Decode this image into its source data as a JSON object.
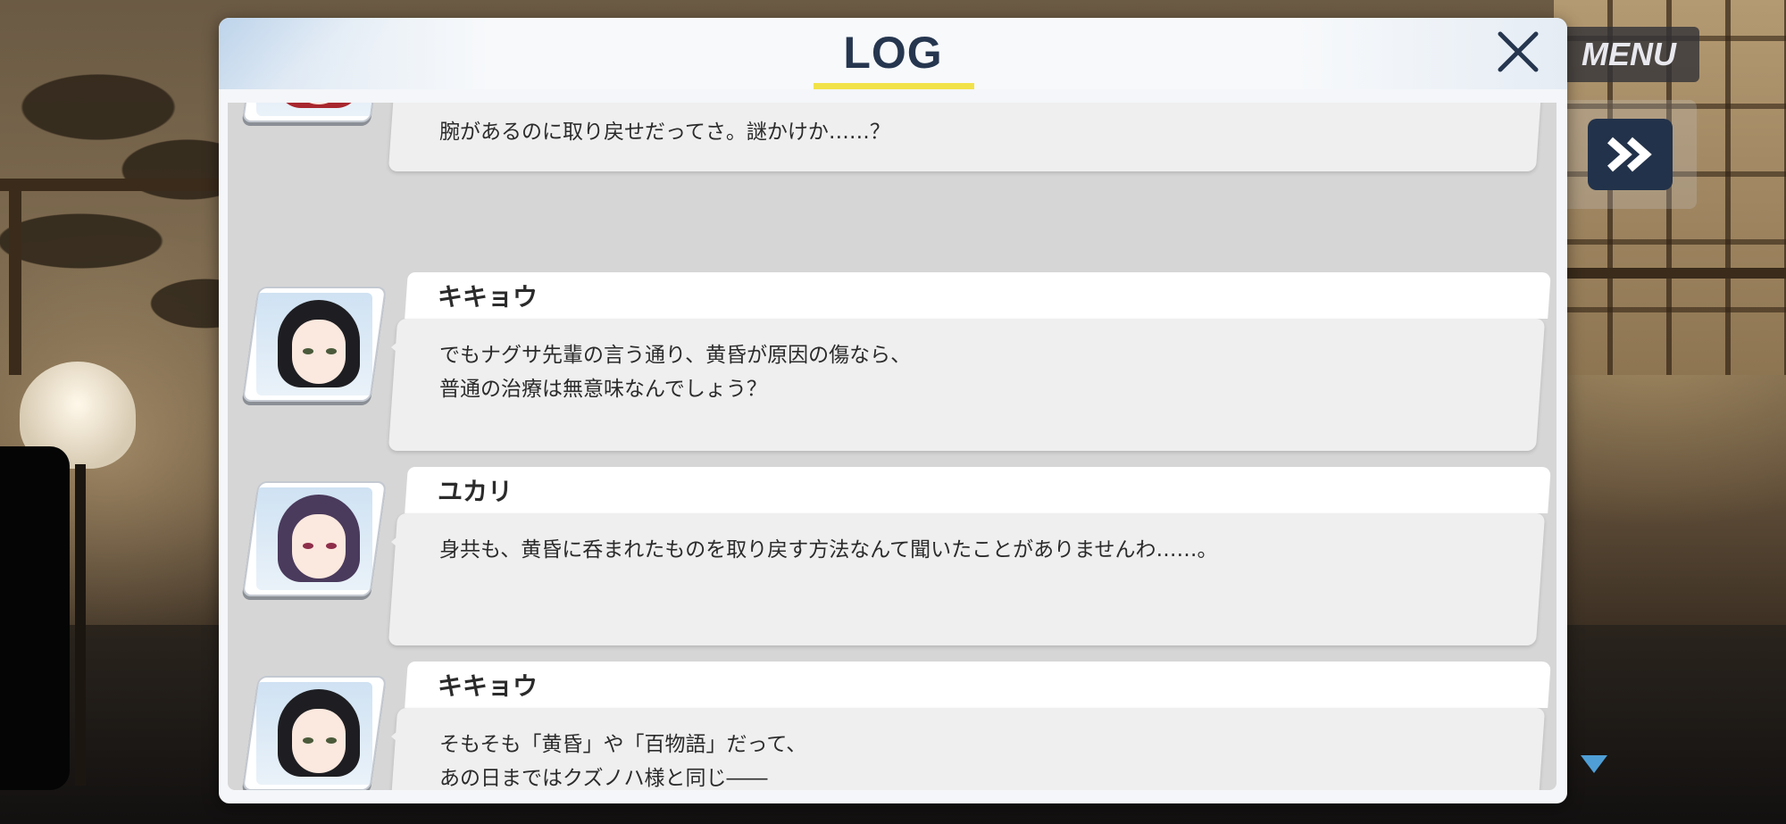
{
  "background": {
    "menu_label": "MENU"
  },
  "dialog": {
    "title": "LOG",
    "close_icon": "close-x",
    "accent_color": "#f2e24a",
    "entries": [
      {
        "speaker": "",
        "avatar": "red-haired-girl",
        "lines": [
          "腕があるのに取り戻せだってさ。謎かけか……？"
        ]
      },
      {
        "speaker": "キキョウ",
        "avatar": "kikyou",
        "lines": [
          "でもナグサ先輩の言う通り、黄昏が原因の傷なら、",
          "普通の治療は無意味なんでしょう？"
        ]
      },
      {
        "speaker": "ユカリ",
        "avatar": "yukari",
        "lines": [
          "身共も、黄昏に呑まれたものを取り戻す方法なんて聞いたことがありませんわ……。"
        ]
      },
      {
        "speaker": "キキョウ",
        "avatar": "kikyou",
        "lines": [
          "そもそも「黄昏」や「百物語」だって、",
          "あの日まではクズノハ様と同じ――"
        ]
      }
    ]
  }
}
